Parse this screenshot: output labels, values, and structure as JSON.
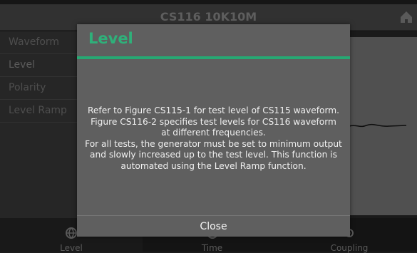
{
  "app": {
    "title": "CS116 10K10M"
  },
  "sidebar": {
    "items": [
      {
        "label": "Waveform"
      },
      {
        "label": "Level"
      },
      {
        "label": "Polarity"
      },
      {
        "label": "Level Ramp"
      }
    ]
  },
  "bottom_nav": {
    "tabs": [
      {
        "label": "Level",
        "icon": "globe-icon"
      },
      {
        "label": "Time",
        "icon": "clock-icon"
      },
      {
        "label": "Coupling",
        "icon": "coupling-icon"
      }
    ]
  },
  "dialog": {
    "title": "Level",
    "lines": [
      "Refer to Figure CS115-1 for test level of CS115 waveform.",
      "Figure CS116-2 specifies test levels for CS116 waveform",
      "at different frequencies.",
      "For all tests, the generator must be set to minimum output",
      "and slowly increased up to the test level. This function is",
      "automated using the Level Ramp function."
    ],
    "close_label": "Close"
  },
  "colors": {
    "accent": "#2fb07a",
    "modal_bg": "#5f5f5f",
    "app_bg": "#1c1c1c"
  }
}
